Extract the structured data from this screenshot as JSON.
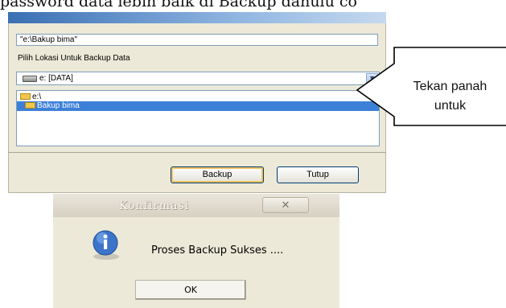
{
  "document": {
    "heading_fragment": "password data lebih baik di Backup dahulu co"
  },
  "backup_dialog": {
    "path_value": "\"e:\\Bakup bima\"",
    "location_label": "Pilih Lokasi Untuk Backup Data",
    "drive_selected": "e: [DATA]",
    "folders": {
      "root": "e:\\",
      "selected": "Bakup bima"
    },
    "backup_button": "Backup",
    "close_button": "Tutup"
  },
  "callout": {
    "line1": "Tekan panah",
    "line2": "untuk"
  },
  "confirmation_dialog": {
    "title": "Konfirmasi",
    "close_glyph": "✕",
    "message": "Proses Backup Sukses ....",
    "ok_button": "OK"
  },
  "icons": {
    "drive": "hard-drive-icon",
    "folder": "folder-icon",
    "dropdown": "chevron-down-icon",
    "info": "info-icon",
    "close": "close-icon"
  },
  "colors": {
    "selection": "#3d80d8",
    "dialog_bg": "#ece9d8",
    "focus_ring": "#f2c35d"
  }
}
